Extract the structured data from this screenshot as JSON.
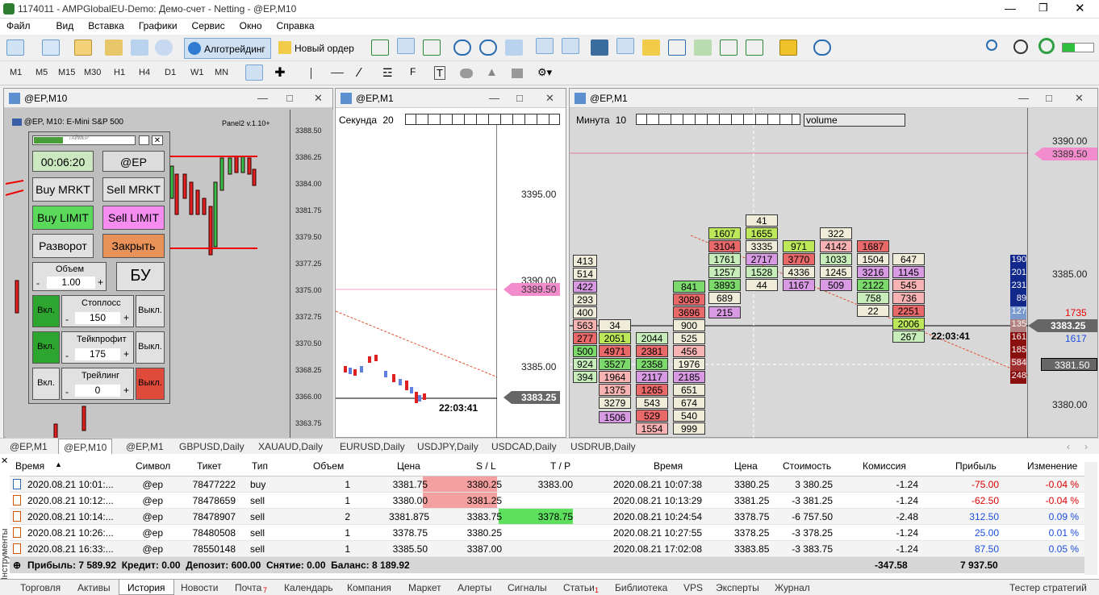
{
  "window": {
    "title": "1174011 - AMPGlobalEU-Demo: Демо-счет - Netting - @EP,M10"
  },
  "menu": [
    "Файл",
    "Вид",
    "Вставка",
    "Графики",
    "Сервис",
    "Окно",
    "Справка"
  ],
  "toolbar": {
    "algo": "Алготрейдинг",
    "new_order": "Новый ордер"
  },
  "timeframes": [
    "M1",
    "M5",
    "M15",
    "M30",
    "H1",
    "H4",
    "D1",
    "W1",
    "MN"
  ],
  "charts": {
    "left": {
      "title": "@EP,M10",
      "header": "@EP, M10:  E-Mini S&P 500",
      "panel_label": "Panel2 v.1.10+",
      "axis": [
        "3388.50",
        "3386.25",
        "3384.00",
        "3381.75",
        "3379.50",
        "3377.25",
        "3375.00",
        "3372.75",
        "3370.50",
        "3368.25",
        "3366.00",
        "3363.75"
      ]
    },
    "mid": {
      "title": "@EP,M1",
      "mode": "Секунда",
      "mode_val": "20",
      "axis": [
        "3395.00",
        "3390.00",
        "3385.00"
      ],
      "ask_label": "3389.50",
      "bid_label": "3383.25",
      "time": "22:03:41"
    },
    "right": {
      "title": "@EP,M1",
      "mode": "Минута",
      "mode_val": "10",
      "volume": "volume",
      "axis": [
        "3390.00",
        "3385.00",
        "3380.00"
      ],
      "ask_label": "3389.50",
      "bid_label": "3383.25",
      "last_label": "3381.50",
      "time": "22:03:41",
      "right_top": "1735",
      "right_bot": "1617",
      "edge_vals": [
        "190",
        "201",
        "231",
        "89",
        "127",
        "135",
        "161",
        "185",
        "584",
        "248"
      ]
    }
  },
  "panel": {
    "timer_label": "ТАЙМЕР",
    "timer": "00:06:20",
    "symbol": "@EP",
    "buy_mrkt": "Buy MRKT",
    "sell_mrkt": "Sell MRKT",
    "buy_limit": "Buy LIMIT",
    "sell_limit": "Sell LIMIT",
    "reverse": "Разворот",
    "close": "Закрыть",
    "volume_label": "Объем",
    "volume": "1.00",
    "bu": "БУ",
    "sl_label": "Стоплосс",
    "sl_val": "150",
    "tp_label": "Тейкпрофит",
    "tp_val": "175",
    "trail_label": "Трейлинг",
    "trail_val": "0",
    "on": "Вкл.",
    "off": "Выкл.",
    "minus": "-",
    "plus": "+"
  },
  "chart_tabs": [
    "@EP,M1",
    "@EP,M10",
    "@EP,M1",
    "GBPUSD,Daily",
    "XAUAUD,Daily",
    "EURUSD,Daily",
    "USDJPY,Daily",
    "USDCAD,Daily",
    "USDRUB,Daily"
  ],
  "table": {
    "headers": [
      "Время",
      "Символ",
      "Тикет",
      "Тип",
      "Объем",
      "Цена",
      "S / L",
      "T / P",
      "Время",
      "Цена",
      "Стоимость",
      "Комиссия",
      "Прибыль",
      "Изменение"
    ],
    "rows": [
      [
        "2020.08.21 10:01:...",
        "@ep",
        "78477222",
        "buy",
        "1",
        "3381.75",
        "3380.25",
        "3383.00",
        "2020.08.21 10:07:38",
        "3380.25",
        "3 380.25",
        "-1.24",
        "-75.00",
        "-0.04 %"
      ],
      [
        "2020.08.21 10:12:...",
        "@ep",
        "78478659",
        "sell",
        "1",
        "3380.00",
        "3381.25",
        "",
        "2020.08.21 10:13:29",
        "3381.25",
        "-3 381.25",
        "-1.24",
        "-62.50",
        "-0.04 %"
      ],
      [
        "2020.08.21 10:14:...",
        "@ep",
        "78478907",
        "sell",
        "2",
        "3381.875",
        "3383.75",
        "3378.75",
        "2020.08.21 10:24:54",
        "3378.75",
        "-6 757.50",
        "-2.48",
        "312.50",
        "0.09 %"
      ],
      [
        "2020.08.21 10:26:...",
        "@ep",
        "78480508",
        "sell",
        "1",
        "3378.75",
        "3380.25",
        "",
        "2020.08.21 10:27:55",
        "3378.25",
        "-3 378.25",
        "-1.24",
        "25.00",
        "0.01 %"
      ],
      [
        "2020.08.21 16:33:...",
        "@ep",
        "78550148",
        "sell",
        "1",
        "3385.50",
        "3387.00",
        "",
        "2020.08.21 17:02:08",
        "3383.85",
        "-3 383.75",
        "-1.24",
        "87.50",
        "0.05 %"
      ]
    ],
    "summary": "Прибыль: 7 589.92  Кредит: 0.00  Депозит: 600.00  Снятие: 0.00  Баланс: 8 189.92",
    "sum_commission": "-347.58",
    "sum_profit": "7 937.50"
  },
  "side_label": "Инструменты",
  "bottom_tabs": [
    "Торговля",
    "Активы",
    "История",
    "Новости",
    "Почта",
    "Календарь",
    "Компания",
    "Маркет",
    "Алерты",
    "Сигналы",
    "Статьи",
    "Библиотека",
    "VPS",
    "Эксперты",
    "Журнал"
  ],
  "mail_badge": "7",
  "articles_badge": "1",
  "strategy_tester": "Тестер стратегий"
}
